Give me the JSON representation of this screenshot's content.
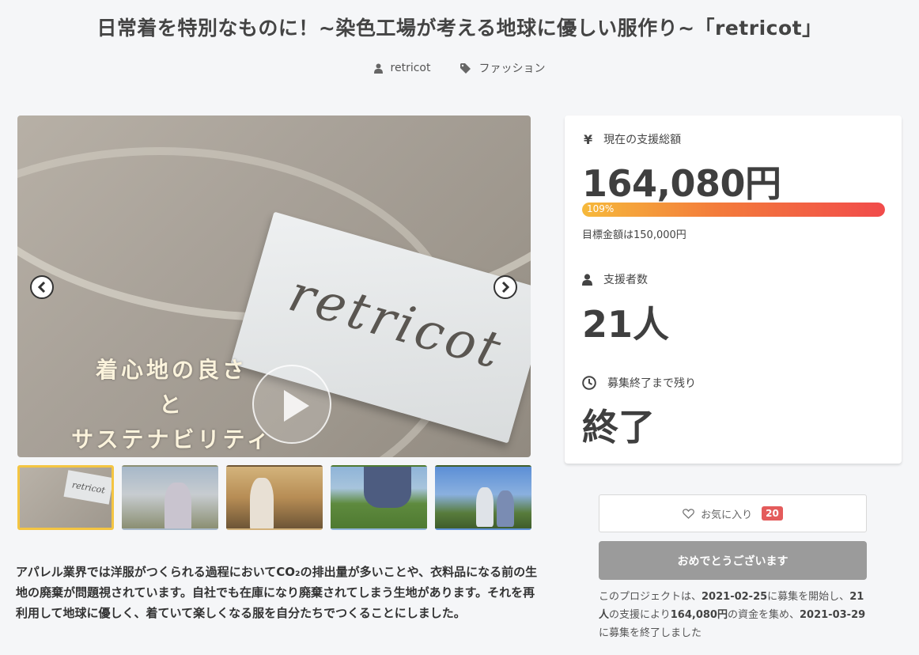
{
  "project": {
    "title": "日常着を特別なものに！~染色工場が考える地球に優しい服作り~「retricot」",
    "owner": "retricot",
    "category": "ファッション"
  },
  "hero": {
    "label_text": "retricot",
    "overlay_line1": "着心地の良さ",
    "overlay_line2": "と",
    "overlay_line3": "サステナビリティ"
  },
  "thumbnails": [
    {
      "name": "thumb-1",
      "active": true
    },
    {
      "name": "thumb-2",
      "active": false
    },
    {
      "name": "thumb-3",
      "active": false
    },
    {
      "name": "thumb-4",
      "active": false
    },
    {
      "name": "thumb-5",
      "active": false
    }
  ],
  "description": "アパレル業界では洋服がつくられる過程においてCO₂の排出量が多いことや、衣料品になる前の生地の廃棄が問題視されています。自社でも在庫になり廃棄されてしまう生地があります。それを再利用して地球に優しく、着ていて楽しくなる服を自分たちでつくることにしました。",
  "stats": {
    "amount_label": "現在の支援総額",
    "amount": "164,080円",
    "progress_text": "109%",
    "progress_value": 1.09,
    "goal_text": "目標金額は150,000円",
    "backers_label": "支援者数",
    "backers": "21人",
    "remaining_label": "募集終了まで残り",
    "remaining": "終了"
  },
  "actions": {
    "favorite_label": "お気に入り",
    "favorite_count": "20",
    "congrats_label": "おめでとうございます"
  },
  "summary": {
    "t1": "このプロジェクトは、",
    "start": "2021-02-25",
    "t2": "に募集を開始し、",
    "backers": "21人",
    "t3": "の支援により",
    "amount": "164,080円",
    "t4": "の資金を集め、",
    "end": "2021-03-29",
    "t5": "に募集を終了しました"
  },
  "colors": {
    "progress_start": "#f6b93b",
    "progress_end": "#f14b4b",
    "badge": "#e45b5b",
    "active_thumb_border": "#f4c542"
  }
}
